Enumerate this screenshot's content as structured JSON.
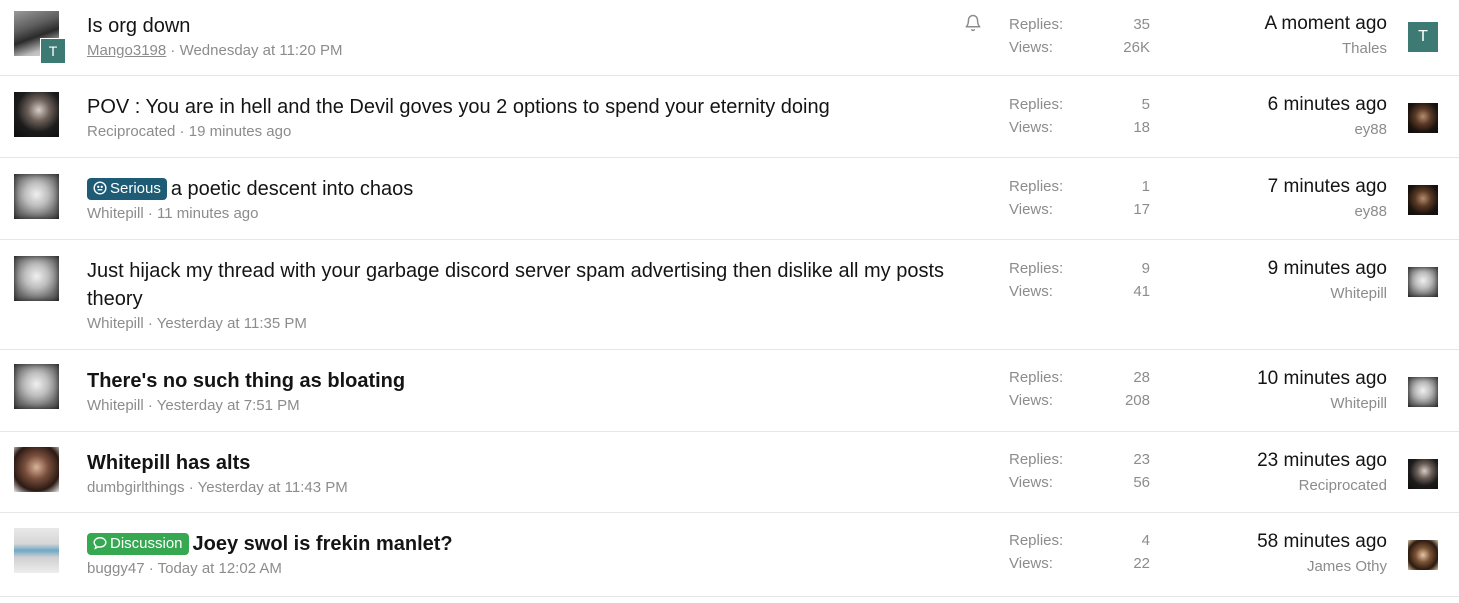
{
  "threads": [
    {
      "title": "Is org down",
      "bold": false,
      "label": null,
      "author": "Mango3198",
      "date": "Wednesday at 11:20 PM",
      "avatar_badge": "T",
      "watched": true,
      "replies_label": "Replies:",
      "replies": "35",
      "views_label": "Views:",
      "views": "26K",
      "last_time": "A moment ago",
      "last_user": "Thales",
      "last_avatar_letter": "T"
    },
    {
      "title": "POV : You are in hell and the Devil goves you 2 options to spend your eternity doing",
      "bold": false,
      "label": null,
      "author": "Reciprocated",
      "date": "19 minutes ago",
      "replies_label": "Replies:",
      "replies": "5",
      "views_label": "Views:",
      "views": "18",
      "last_time": "6 minutes ago",
      "last_user": "ey88"
    },
    {
      "title": "a poetic descent into chaos",
      "bold": false,
      "label": "Serious",
      "author": "Whitepill",
      "date": "11 minutes ago",
      "replies_label": "Replies:",
      "replies": "1",
      "views_label": "Views:",
      "views": "17",
      "last_time": "7 minutes ago",
      "last_user": "ey88"
    },
    {
      "title": "Just hijack my thread with your garbage discord server spam advertising then dislike all my posts theory",
      "bold": false,
      "label": null,
      "author": "Whitepill",
      "date": "Yesterday at 11:35 PM",
      "replies_label": "Replies:",
      "replies": "9",
      "views_label": "Views:",
      "views": "41",
      "last_time": "9 minutes ago",
      "last_user": "Whitepill"
    },
    {
      "title": "There's no such thing as bloating",
      "bold": true,
      "label": null,
      "author": "Whitepill",
      "date": "Yesterday at 7:51 PM",
      "replies_label": "Replies:",
      "replies": "28",
      "views_label": "Views:",
      "views": "208",
      "last_time": "10 minutes ago",
      "last_user": "Whitepill"
    },
    {
      "title": "Whitepill has alts",
      "bold": true,
      "label": null,
      "author": "dumbgirlthings",
      "date": "Yesterday at 11:43 PM",
      "replies_label": "Replies:",
      "replies": "23",
      "views_label": "Views:",
      "views": "56",
      "last_time": "23 minutes ago",
      "last_user": "Reciprocated"
    },
    {
      "title": "Joey swol is frekin manlet?",
      "bold": true,
      "label": "Discussion",
      "author": "buggy47",
      "date": "Today at 12:02 AM",
      "replies_label": "Replies:",
      "replies": "4",
      "views_label": "Views:",
      "views": "22",
      "last_time": "58 minutes ago",
      "last_user": "James Othy"
    }
  ],
  "meta_separator": " · ",
  "colors": {
    "label_serious": "#1d5c74",
    "label_discussion": "#36a852",
    "avatar_teal": "#3e7a74",
    "muted_text": "#8c8c8c"
  }
}
